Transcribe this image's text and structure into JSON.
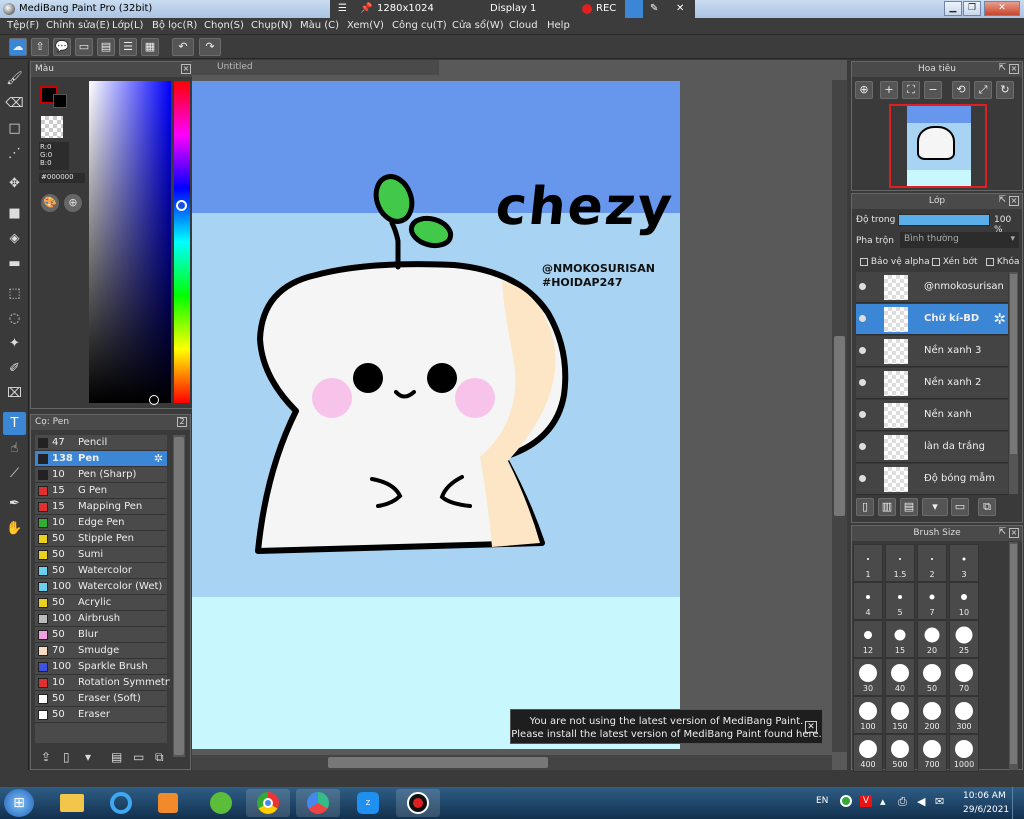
{
  "window": {
    "title": "MediBang Paint Pro (32bit)",
    "resolution": "1280x1024",
    "display": "Display 1",
    "rec_label": "REC"
  },
  "menu": [
    "Tệp(F)",
    "Chỉnh sửa(E)",
    "Lớp(L)",
    "Bộ lọc(R)",
    "Chọn(S)",
    "Chụp(N)",
    "Màu (C)",
    "Xem(V)",
    "Công cụ(T)",
    "Cửa sổ(W)",
    "Cloud",
    "Help"
  ],
  "color_panel": {
    "title": "Màu",
    "r": "R:0",
    "g": "G:0",
    "b": "B:0",
    "hex": "#000000",
    "primary": "#000000",
    "accent": "#cc0000"
  },
  "brush_panel": {
    "title": "Cọ: Pen",
    "items": [
      {
        "size": "47",
        "name": "Pencil",
        "color": "#222222"
      },
      {
        "size": "138",
        "name": "Pen",
        "color": "#222222",
        "active": true
      },
      {
        "size": "10",
        "name": "Pen (Sharp)",
        "color": "#222222"
      },
      {
        "size": "15",
        "name": "G Pen",
        "color": "#e03030"
      },
      {
        "size": "15",
        "name": "Mapping Pen",
        "color": "#e03030"
      },
      {
        "size": "10",
        "name": "Edge Pen",
        "color": "#30b030"
      },
      {
        "size": "50",
        "name": "Stipple Pen",
        "color": "#e8d020"
      },
      {
        "size": "50",
        "name": "Sumi",
        "color": "#e8d020"
      },
      {
        "size": "50",
        "name": "Watercolor",
        "color": "#6ad0f0"
      },
      {
        "size": "100",
        "name": "Watercolor (Wet)",
        "color": "#6ad0f0"
      },
      {
        "size": "50",
        "name": "Acrylic",
        "color": "#e8d020"
      },
      {
        "size": "100",
        "name": "Airbrush",
        "color": "#bbbbbb"
      },
      {
        "size": "50",
        "name": "Blur",
        "color": "#f0a0e0"
      },
      {
        "size": "70",
        "name": "Smudge",
        "color": "#f6dcc0"
      },
      {
        "size": "100",
        "name": "Sparkle Brush",
        "color": "#4050e0"
      },
      {
        "size": "10",
        "name": "Rotation Symmetry Pen",
        "color": "#e03030"
      },
      {
        "size": "50",
        "name": "Eraser (Soft)",
        "color": "#ffffff"
      },
      {
        "size": "50",
        "name": "Eraser",
        "color": "#ffffff"
      }
    ]
  },
  "document": {
    "tab": "Untitled",
    "signature": "chezy",
    "credit_1": "@NMOKOSURISAN",
    "credit_2": "#HOIDAP247"
  },
  "navigator": {
    "title": "Hoa tiêu"
  },
  "layers": {
    "title": "Lớp",
    "opacity_label": "Độ trong",
    "opacity_value": "100 %",
    "blend_label": "Pha trộn",
    "blend_value": "Bình thường",
    "protect_alpha": "Bảo vệ alpha",
    "clipping": "Xén bớt",
    "lock": "Khóa",
    "items": [
      {
        "name": "@nmokosurisan"
      },
      {
        "name": "Chữ kí-BD",
        "active": true
      },
      {
        "name": "Nền xanh 3"
      },
      {
        "name": "Nền xanh 2"
      },
      {
        "name": "Nền xanh"
      },
      {
        "name": "làn da trắng"
      },
      {
        "name": "Độ bóng mẫm"
      }
    ]
  },
  "brush_size": {
    "title": "Brush Size",
    "sizes": [
      "1",
      "1.5",
      "2",
      "3",
      "4",
      "5",
      "7",
      "10",
      "12",
      "15",
      "20",
      "25",
      "30",
      "40",
      "50",
      "70",
      "100",
      "150",
      "200",
      "300",
      "400",
      "500",
      "700",
      "1000"
    ]
  },
  "notice": {
    "line1": "You are not using the latest version of MediBang Paint.",
    "line2": "Please install the latest version of MediBang Paint found here."
  },
  "taskbar": {
    "lang": "EN",
    "time": "10:06 AM",
    "date": "29/6/2021"
  }
}
